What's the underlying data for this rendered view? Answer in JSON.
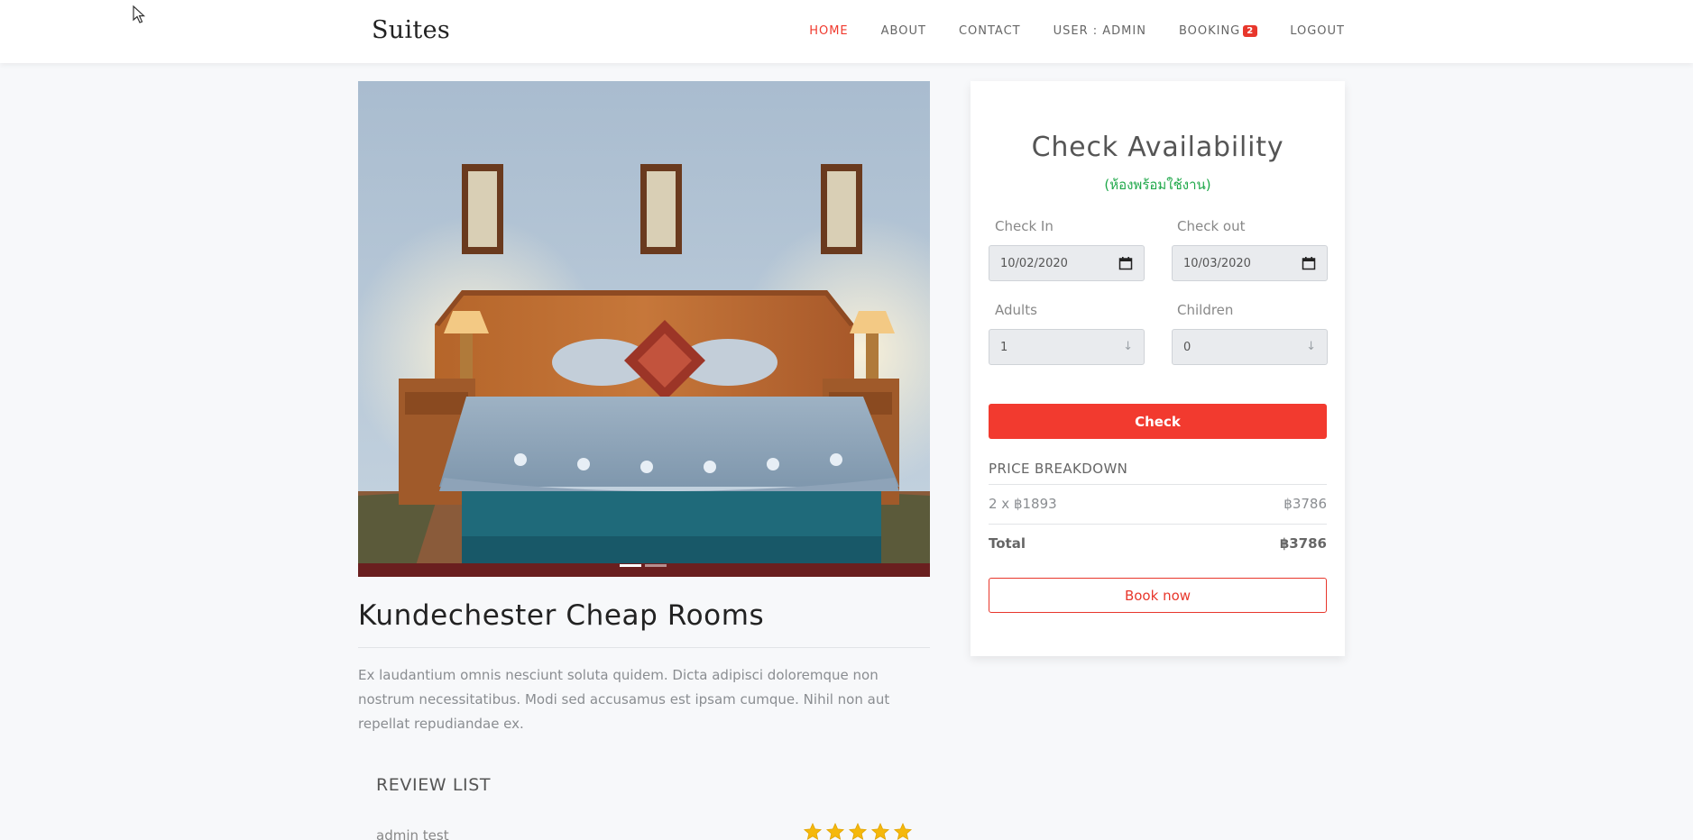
{
  "header": {
    "brand": "Suites",
    "nav": [
      {
        "label": "HOME",
        "active": true
      },
      {
        "label": "ABOUT"
      },
      {
        "label": "CONTACT"
      },
      {
        "label": "USER : ADMIN"
      },
      {
        "label": "BOOKING",
        "badge": "2"
      },
      {
        "label": "LOGOUT"
      }
    ]
  },
  "room": {
    "title": "Kundechester Cheap Rooms",
    "description": "Ex laudantium omnis nesciunt soluta quidem. Dicta adipisci doloremque non nostrum necessitatibus. Modi sed accusamus est ipsam cumque. Nihil non aut repellat repudiandae ex.",
    "carousel_slides": 2,
    "carousel_active_slide": 1
  },
  "reviews": {
    "heading": "REVIEW LIST",
    "items": [
      {
        "user": "admin test",
        "rating": 5
      }
    ]
  },
  "availability": {
    "title": "Check Availability",
    "status": "(ห้องพร้อมใช้งาน)",
    "check_in_label": "Check In",
    "check_in_value": "10/02/2020",
    "check_out_label": "Check out",
    "check_out_value": "10/03/2020",
    "adults_label": "Adults",
    "adults_value": "1",
    "children_label": "Children",
    "children_value": "0",
    "check_button": "Check",
    "price_heading": "PRICE BREAKDOWN",
    "line_item_label": "2 x ฿1893",
    "line_item_amount": "฿3786",
    "total_label": "Total",
    "total_amount": "฿3786",
    "book_button": "Book now"
  },
  "colors": {
    "accent": "#f23a2f",
    "status_green": "#1fa84a",
    "star": "#f5b80c"
  },
  "icons": {
    "date": "calendar-icon",
    "select": "arrow-down-icon",
    "rating": "star-icon"
  }
}
